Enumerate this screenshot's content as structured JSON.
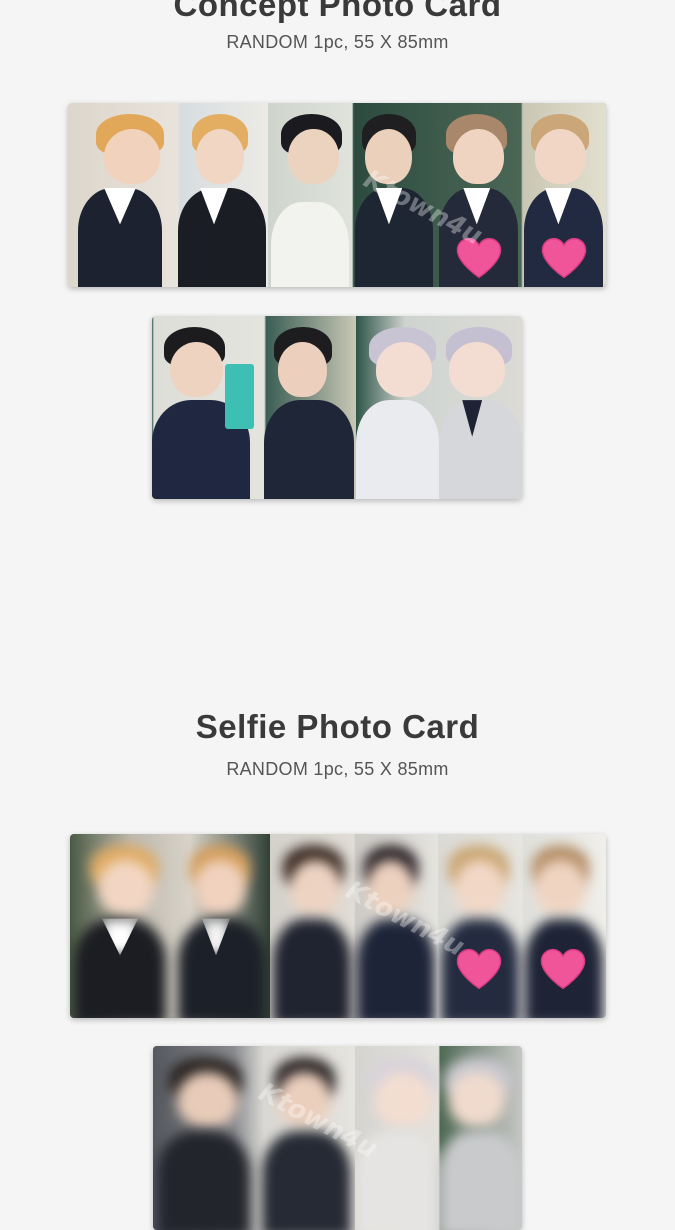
{
  "concept": {
    "title": "Concept Photo Card",
    "subtitle": "RANDOM 1pc, 55 X 85mm"
  },
  "selfie": {
    "title": "Selfie Photo Card",
    "subtitle": "RANDOM 1pc, 55 X 85mm"
  },
  "watermark": "Ktown4u",
  "heart_color": "#f0559a",
  "icons": [
    "heart-icon"
  ]
}
